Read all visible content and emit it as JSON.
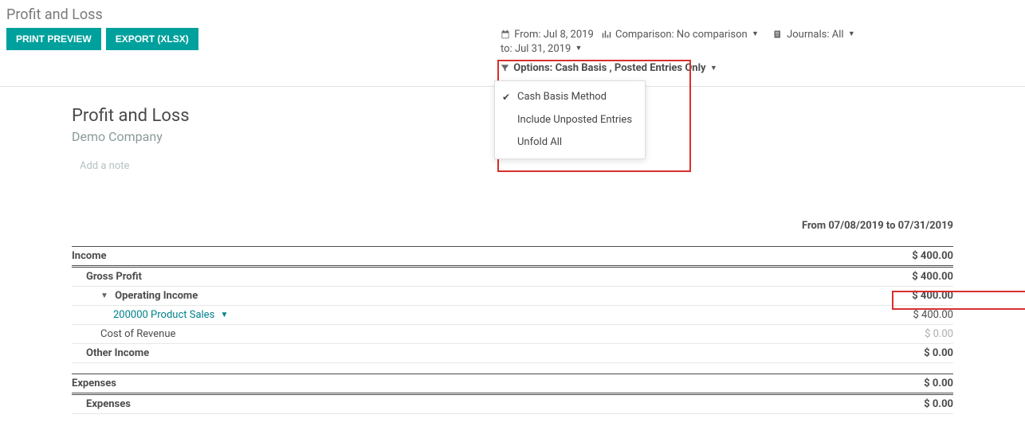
{
  "header": {
    "page_title": "Profit and Loss",
    "buttons": {
      "print_preview": "PRINT PREVIEW",
      "export_xlsx": "EXPORT (XLSX)"
    }
  },
  "filters": {
    "date_from_label": "From:",
    "date_from_value": "Jul 8, 2019",
    "date_to_label": "to:",
    "date_to_value": "Jul 31, 2019",
    "comparison_label": "Comparison:",
    "comparison_value": "No comparison",
    "journals_label": "Journals:",
    "journals_value": "All",
    "options_label": "Options:",
    "options_value": "Cash Basis , Posted Entries Only"
  },
  "options_dropdown": {
    "item1": "Cash Basis Method",
    "item2": "Include Unposted Entries",
    "item3": "Unfold All"
  },
  "report": {
    "title": "Profit and Loss",
    "company": "Demo Company",
    "note_placeholder": "Add a note",
    "date_range": "From 07/08/2019 to 07/31/2019",
    "income_label": "Income",
    "income_value": "$ 400.00",
    "gross_profit_label": "Gross Profit",
    "gross_profit_value": "$ 400.00",
    "operating_income_label": "Operating Income",
    "operating_income_value": "$ 400.00",
    "product_sales_label": "200000 Product Sales",
    "product_sales_value": "$ 400.00",
    "cost_of_revenue_label": "Cost of Revenue",
    "cost_of_revenue_value": "$ 0.00",
    "other_income_label": "Other Income",
    "other_income_value": "$ 0.00",
    "expenses_header_label": "Expenses",
    "expenses_header_value": "$ 0.00",
    "expenses_sub_label": "Expenses",
    "expenses_sub_value": "$ 0.00"
  }
}
